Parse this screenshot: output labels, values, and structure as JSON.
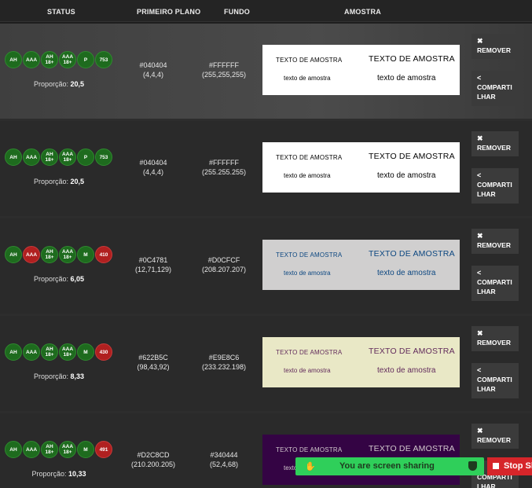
{
  "header": {
    "status": "STATUS",
    "foreground": "PRIMEIRO PLANO",
    "background": "FUNDO",
    "sample": "AMOSTRA"
  },
  "ratio_prefix": "Proporção:",
  "remove_label": "REMOVER",
  "share_label_1": "COMPARTI",
  "share_label_2": "LHAR",
  "sample_upper": "TEXTO DE AMOSTRA",
  "sample_lower": "texto de amostra",
  "rows": [
    {
      "badges": [
        "AH",
        "AAA",
        "AH 18+",
        "AAA 18+",
        "P",
        "753"
      ],
      "badge_states": [
        "ok",
        "ok",
        "ok",
        "ok",
        "ok",
        "ok"
      ],
      "ratio": "20,5",
      "fg_hex": "#040404",
      "fg_rgb": "(4,4,4)",
      "bg_hex": "#FFFFFF",
      "bg_rgb": "(255,255,255)",
      "fg_color": "#040404",
      "bg_color": "#FFFFFF"
    },
    {
      "badges": [
        "AH",
        "AAA",
        "AH 18+",
        "AAA 18+",
        "P",
        "753"
      ],
      "badge_states": [
        "ok",
        "ok",
        "ok",
        "ok",
        "ok",
        "ok"
      ],
      "ratio": "20,5",
      "fg_hex": "#040404",
      "fg_rgb": "(4,4,4)",
      "bg_hex": "#FFFFFF",
      "bg_rgb": "(255.255.255)",
      "fg_color": "#040404",
      "bg_color": "#FFFFFF"
    },
    {
      "badges": [
        "AH",
        "AAA",
        "AH 18+",
        "AAA 18+",
        "M",
        "410"
      ],
      "badge_states": [
        "ok",
        "bad",
        "ok",
        "ok",
        "ok",
        "bad"
      ],
      "ratio": "6,05",
      "fg_hex": "#0C4781",
      "fg_rgb": "(12,71,129)",
      "bg_hex": "#D0CFCF",
      "bg_rgb": "(208.207.207)",
      "fg_color": "#0C4781",
      "bg_color": "#D0CFCF"
    },
    {
      "badges": [
        "AH",
        "AAA",
        "AH 18+",
        "AAA 18+",
        "M",
        "430"
      ],
      "badge_states": [
        "ok",
        "ok",
        "ok",
        "ok",
        "ok",
        "bad"
      ],
      "ratio": "8,33",
      "fg_hex": "#622B5C",
      "fg_rgb": "(98,43,92)",
      "bg_hex": "#E9E8C6",
      "bg_rgb": "(233.232.198)",
      "fg_color": "#622B5C",
      "bg_color": "#E9E8C6"
    },
    {
      "badges": [
        "AH",
        "AAA",
        "AH 18+",
        "AAA 18+",
        "M",
        "491"
      ],
      "badge_states": [
        "ok",
        "ok",
        "ok",
        "ok",
        "ok",
        "bad"
      ],
      "ratio": "10,33",
      "fg_hex": "#D2C8CD",
      "fg_rgb": "(210.200.205)",
      "bg_hex": "#340444",
      "bg_rgb": "(52,4,68)",
      "fg_color": "#D2C8CD",
      "bg_color": "#340444"
    }
  ],
  "screen_share": {
    "message": "You are screen sharing",
    "stop_label": "Stop Sh"
  },
  "colors": {
    "pass_badge": "#1e6b1e",
    "fail_badge": "#b02020",
    "share_bar": "#2fcf5a",
    "stop_bar": "#d6252a"
  }
}
